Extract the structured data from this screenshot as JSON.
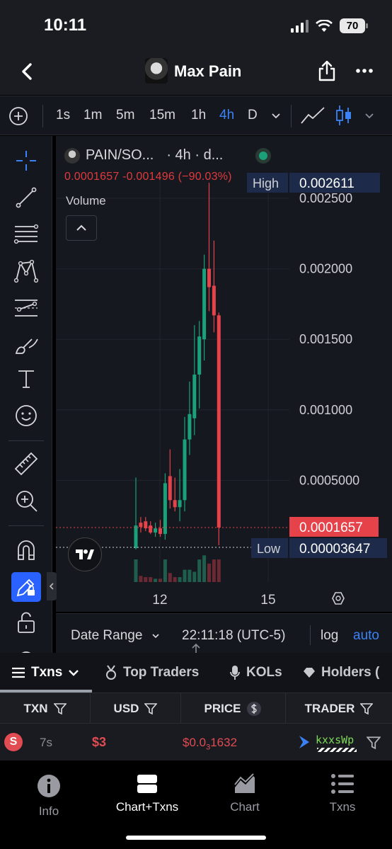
{
  "status": {
    "time": "10:11",
    "battery": "70"
  },
  "header": {
    "title": "Max Pain"
  },
  "intervals": {
    "items": [
      "1s",
      "1m",
      "5m",
      "15m",
      "1h",
      "4h",
      "D"
    ],
    "active": "4h"
  },
  "chart": {
    "symbol": "PAIN/SO...",
    "interval_text": "· 4h · d...",
    "ohlc_text": "0.0001657  -0.001496 (−90.03%)",
    "volume_label": "Volume",
    "high_label": "High",
    "high_value": "0.002611",
    "low_label": "Low",
    "low_value": "0.00003647",
    "last_price": "0.0001657",
    "colors": {
      "up": "#1aa179",
      "down": "#e5424a",
      "background": "#16181f"
    }
  },
  "chart_data": {
    "type": "candlestick",
    "title": "PAIN/SO...",
    "y_ticks": [
      "0.002500",
      "0.002000",
      "0.001500",
      "0.001000",
      "0.0005000"
    ],
    "x_ticks": [
      "12",
      "15"
    ],
    "ylim": [
      0,
      0.0027
    ],
    "candles": [
      {
        "x": 1,
        "open": 2e-05,
        "high": 0.00052,
        "low": 1e-05,
        "close": 0.00018,
        "volume": 0.55,
        "dir": "up"
      },
      {
        "x": 2,
        "open": 0.0002,
        "high": 0.00024,
        "low": 0.00013,
        "close": 0.00017,
        "volume": 0.15,
        "dir": "down"
      },
      {
        "x": 3,
        "open": 0.00021,
        "high": 0.00024,
        "low": 0.00014,
        "close": 0.00016,
        "volume": 0.12,
        "dir": "down"
      },
      {
        "x": 4,
        "open": 0.00018,
        "high": 0.00021,
        "low": 0.00012,
        "close": 0.00013,
        "volume": 0.12,
        "dir": "down"
      },
      {
        "x": 5,
        "open": 0.00013,
        "high": 0.0002,
        "low": 0.0001,
        "close": 0.00016,
        "volume": 0.08,
        "dir": "up"
      },
      {
        "x": 6,
        "open": 0.00016,
        "high": 0.00022,
        "low": 0.0001,
        "close": 0.00012,
        "volume": 0.08,
        "dir": "down"
      },
      {
        "x": 7,
        "open": 0.00012,
        "high": 0.00055,
        "low": 8e-05,
        "close": 0.00048,
        "volume": 0.55,
        "dir": "up"
      },
      {
        "x": 8,
        "open": 0.00053,
        "high": 0.00072,
        "low": 0.0003,
        "close": 0.00036,
        "volume": 0.22,
        "dir": "down"
      },
      {
        "x": 9,
        "open": 0.00036,
        "high": 0.00052,
        "low": 0.00028,
        "close": 0.00031,
        "volume": 0.12,
        "dir": "down"
      },
      {
        "x": 10,
        "open": 0.00031,
        "high": 0.00058,
        "low": 0.00021,
        "close": 0.00036,
        "volume": 0.12,
        "dir": "up"
      },
      {
        "x": 11,
        "open": 0.00036,
        "high": 0.00095,
        "low": 0.00028,
        "close": 0.00079,
        "volume": 0.3,
        "dir": "up"
      },
      {
        "x": 12,
        "open": 0.00079,
        "high": 0.0012,
        "low": 0.00068,
        "close": 0.00097,
        "volume": 0.3,
        "dir": "up"
      },
      {
        "x": 13,
        "open": 0.00094,
        "high": 0.0016,
        "low": 0.00082,
        "close": 0.00125,
        "volume": 0.25,
        "dir": "up"
      },
      {
        "x": 14,
        "open": 0.00125,
        "high": 0.00163,
        "low": 0.00101,
        "close": 0.00152,
        "volume": 0.55,
        "dir": "up"
      },
      {
        "x": 15,
        "open": 0.0015,
        "high": 0.0021,
        "low": 0.00135,
        "close": 0.002,
        "volume": 0.65,
        "dir": "up"
      },
      {
        "x": 16,
        "open": 0.002,
        "high": 0.00261,
        "low": 0.0017,
        "close": 0.00187,
        "volume": 0.45,
        "dir": "down"
      },
      {
        "x": 17,
        "open": 0.00188,
        "high": 0.0022,
        "low": 0.00155,
        "close": 0.00167,
        "volume": 0.55,
        "dir": "down"
      },
      {
        "x": 18,
        "open": 0.00167,
        "high": 0.00169,
        "low": 4e-05,
        "close": 0.0001657,
        "volume": 0.55,
        "dir": "down"
      }
    ]
  },
  "range_bar": {
    "date_range": "Date Range",
    "time": "22:11:18 (UTC-5)",
    "log": "log",
    "auto": "auto"
  },
  "tabs": {
    "txns": "Txns",
    "top_traders": "Top Traders",
    "kols": "KOLs",
    "holders": "Holders ("
  },
  "table": {
    "headers": {
      "txn": "TXN",
      "usd": "USD",
      "price": "PRICE",
      "trader": "TRADER"
    },
    "rows": [
      {
        "side": "S",
        "age": "7s",
        "usd": "$3",
        "price_prefix": "$0.0",
        "price_sub": "3",
        "price_rest": "1632",
        "trader": "kxxsWp"
      }
    ]
  },
  "bottom_nav": {
    "info": "Info",
    "chart_txns": "Chart+Txns",
    "chart": "Chart",
    "txns": "Txns"
  }
}
